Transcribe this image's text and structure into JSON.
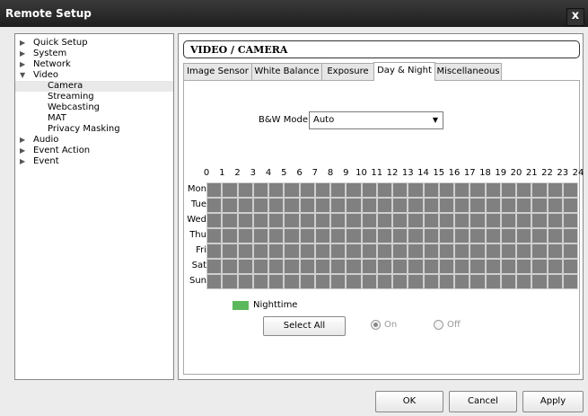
{
  "window": {
    "title": "Remote Setup",
    "close_label": "x"
  },
  "tree": [
    {
      "label": "Quick Setup",
      "arrow": "▶",
      "child": false,
      "selected": false
    },
    {
      "label": "System",
      "arrow": "▶",
      "child": false,
      "selected": false
    },
    {
      "label": "Network",
      "arrow": "▶",
      "child": false,
      "selected": false
    },
    {
      "label": "Video",
      "arrow": "▼",
      "child": false,
      "selected": false
    },
    {
      "label": "Camera",
      "arrow": "",
      "child": true,
      "selected": true
    },
    {
      "label": "Streaming",
      "arrow": "",
      "child": true,
      "selected": false
    },
    {
      "label": "Webcasting",
      "arrow": "",
      "child": true,
      "selected": false
    },
    {
      "label": "MAT",
      "arrow": "",
      "child": true,
      "selected": false
    },
    {
      "label": "Privacy Masking",
      "arrow": "",
      "child": true,
      "selected": false
    },
    {
      "label": "Audio",
      "arrow": "▶",
      "child": false,
      "selected": false
    },
    {
      "label": "Event Action",
      "arrow": "▶",
      "child": false,
      "selected": false
    },
    {
      "label": "Event",
      "arrow": "▶",
      "child": false,
      "selected": false
    }
  ],
  "section_title": "VIDEO / CAMERA",
  "tabs": [
    {
      "label": "Image Sensor",
      "active": false
    },
    {
      "label": "White Balance",
      "active": false
    },
    {
      "label": "Exposure",
      "active": false
    },
    {
      "label": "Day & Night",
      "active": true
    },
    {
      "label": "Miscellaneous",
      "active": false
    }
  ],
  "bw_mode": {
    "label": "B&W Mode",
    "value": "Auto"
  },
  "schedule": {
    "hours": [
      "0",
      "1",
      "2",
      "3",
      "4",
      "5",
      "6",
      "7",
      "8",
      "9",
      "10",
      "11",
      "12",
      "13",
      "14",
      "15",
      "16",
      "17",
      "18",
      "19",
      "20",
      "21",
      "22",
      "23",
      "24"
    ],
    "days": [
      "Mon",
      "Tue",
      "Wed",
      "Thu",
      "Fri",
      "Sat",
      "Sun"
    ]
  },
  "legend": {
    "label": "Nighttime",
    "color": "#5cb85c"
  },
  "select_all_label": "Select All",
  "radio_on": {
    "label": "On",
    "checked": true
  },
  "radio_off": {
    "label": "Off",
    "checked": false
  },
  "buttons": {
    "ok": "OK",
    "cancel": "Cancel",
    "apply": "Apply"
  }
}
